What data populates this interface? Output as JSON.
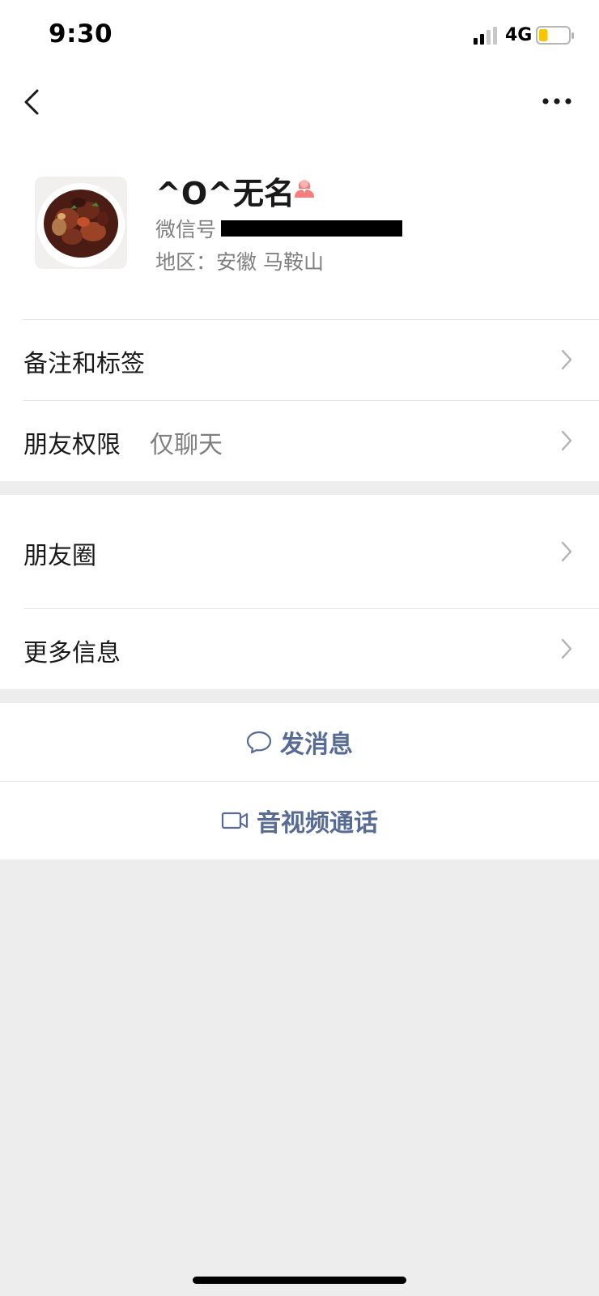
{
  "status_bar": {
    "time": "9:30",
    "network": "4G",
    "battery_level": 0.3,
    "battery_color": "#f7c600"
  },
  "nav": {
    "back_icon": "chevron-left-icon",
    "more_icon": "more-dots-icon"
  },
  "profile": {
    "nickname": "^O^无名",
    "gender_icon": "female-user-icon",
    "gender_color": "#f37e7d",
    "wechat_id_label": "微信号",
    "wechat_id_value_redacted": true,
    "region": "地区：安徽 马鞍山"
  },
  "cells": [
    {
      "label": "备注和标签",
      "value": ""
    },
    {
      "label": "朋友权限",
      "value": "仅聊天"
    },
    {
      "label": "朋友圈",
      "value": ""
    },
    {
      "label": "更多信息",
      "value": ""
    }
  ],
  "actions": {
    "message": {
      "label": "发消息",
      "icon": "chat-bubble-icon"
    },
    "call": {
      "label": "音视频通话",
      "icon": "video-camera-icon"
    }
  },
  "colors": {
    "link": "#576b95",
    "background": "#ededed",
    "secondary_text": "#7f7f7f"
  }
}
